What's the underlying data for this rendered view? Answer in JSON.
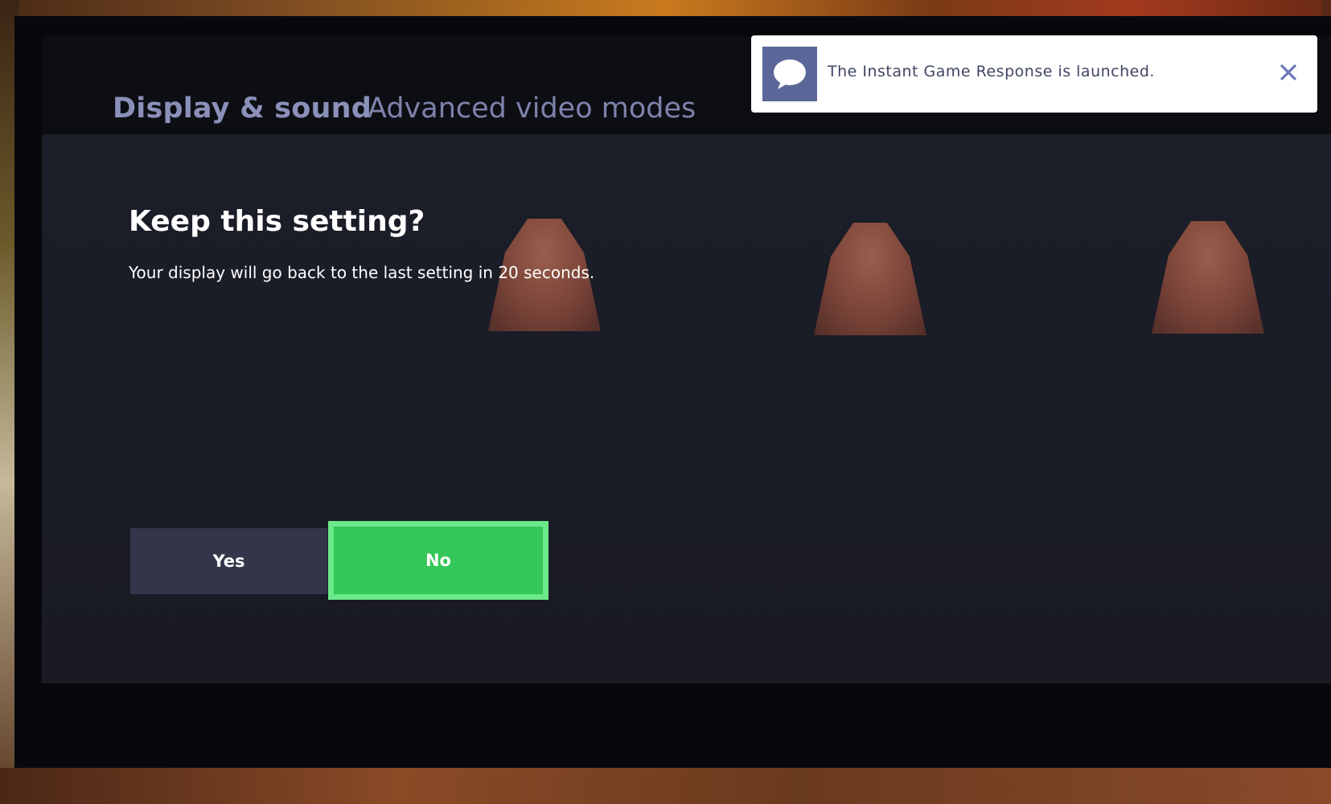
{
  "header": {
    "section": "Display & sound",
    "page": "Advanced video modes"
  },
  "dialog": {
    "title": "Keep this setting?",
    "message": "Your display will go back to the last setting in 20 seconds.",
    "yes_label": "Yes",
    "no_label": "No",
    "focused_button": "No"
  },
  "notification": {
    "icon": "chat-bubble-icon",
    "message": "The Instant Game Response is launched.",
    "close_icon": "close-icon"
  },
  "colors": {
    "focus_green": "#34c759",
    "focus_border": "#6be889",
    "secondary_button": "#33354a",
    "header_text": "#8a90b8",
    "notification_icon_bg": "#5b6699"
  }
}
